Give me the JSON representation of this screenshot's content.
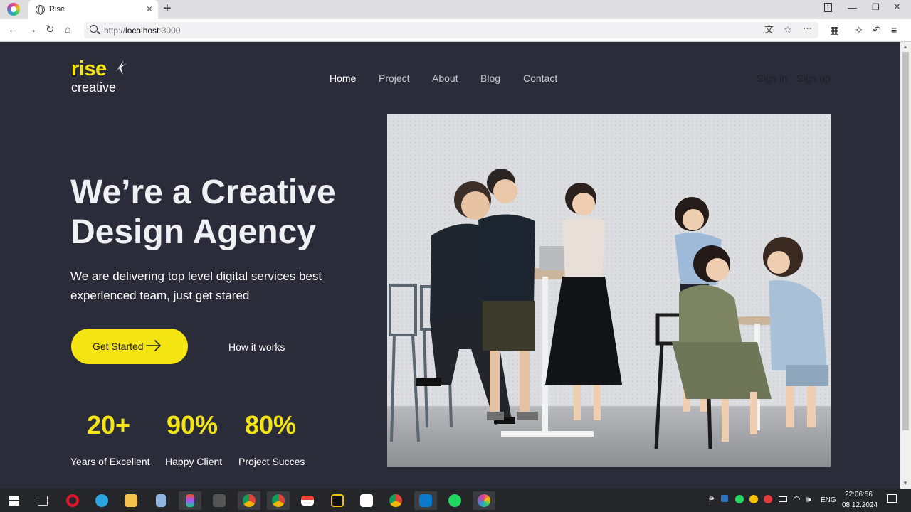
{
  "browser": {
    "tab_title": "Rise",
    "url_scheme": "http://",
    "url_host": "localhost",
    "url_port": ":3000"
  },
  "site": {
    "logo_word": "rise",
    "logo_sub": "creative",
    "nav": [
      "Home",
      "Project",
      "About",
      "Blog",
      "Contact"
    ],
    "active_nav": "Home",
    "sign_in": "Sign in",
    "sign_up": "Sign up",
    "hero_title": "We’re a Creative Design Agency",
    "hero_subtitle": "We are delivering top level digital services best experlenced team, just get stared",
    "cta_label": "Get Started",
    "secondary_label": "How it works",
    "stats": [
      {
        "value": "20+",
        "label": "Years of Excellent"
      },
      {
        "value": "90%",
        "label": "Happy Client"
      },
      {
        "value": "80%",
        "label": "Project Succes"
      }
    ],
    "accent_color": "#f4e411",
    "background_color": "#2a2d39"
  },
  "taskbar": {
    "time": "22:06:56",
    "date": "08.12.2024",
    "lang": "ENG",
    "apps": [
      "windows-start-icon",
      "task-view-icon",
      "opera-icon",
      "telegram-icon",
      "file-explorer-icon",
      "notepad-icon",
      "figma-icon",
      "gimp-icon",
      "chrome-profile-icon",
      "chrome-profile-icon",
      "gmail-icon",
      "app-icon",
      "readymag-icon",
      "chrome-icon",
      "vscode-icon",
      "spotify-icon",
      "browser-icon"
    ]
  }
}
